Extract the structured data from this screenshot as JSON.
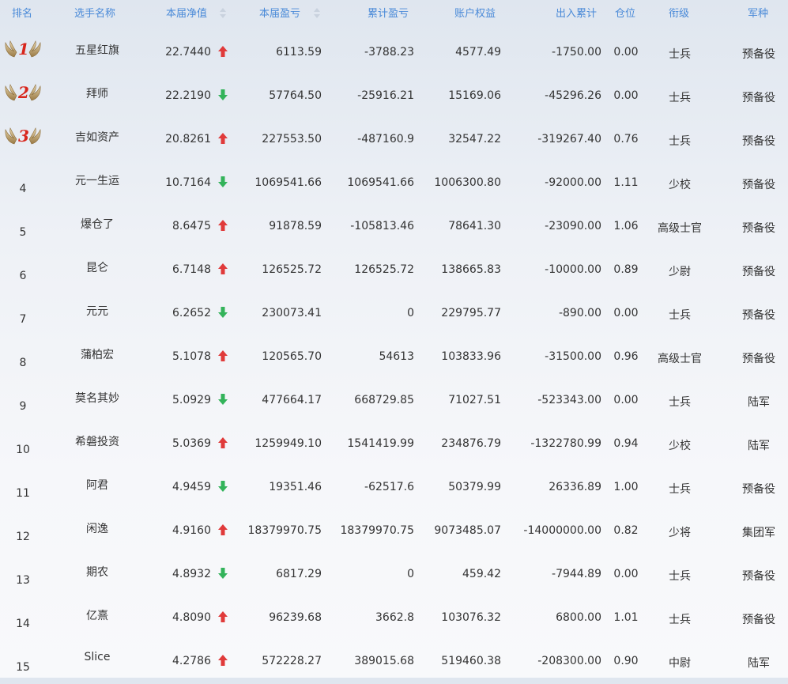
{
  "header": {
    "rank": "排名",
    "name": "选手名称",
    "net_value": "本届净值",
    "pnl": "本届盈亏",
    "cum_pnl": "累计盈亏",
    "equity": "账户权益",
    "io": "出入累计",
    "position": "仓位",
    "title": "衔级",
    "branch": "军种"
  },
  "colors": {
    "up": "#e03a3a",
    "down": "#33b35a",
    "header": "#4a8ad8"
  },
  "rows": [
    {
      "rank": "1",
      "name": "五星红旗",
      "net_value": "22.7440",
      "trend": "up",
      "pnl": "6113.59",
      "cum_pnl": "-3788.23",
      "equity": "4577.49",
      "io": "-1750.00",
      "position": "0.00",
      "title": "士兵",
      "branch": "预备役"
    },
    {
      "rank": "2",
      "name": "拜师",
      "net_value": "22.2190",
      "trend": "down",
      "pnl": "57764.50",
      "cum_pnl": "-25916.21",
      "equity": "15169.06",
      "io": "-45296.26",
      "position": "0.00",
      "title": "士兵",
      "branch": "预备役"
    },
    {
      "rank": "3",
      "name": "吉如资产",
      "net_value": "20.8261",
      "trend": "up",
      "pnl": "227553.50",
      "cum_pnl": "-487160.9",
      "equity": "32547.22",
      "io": "-319267.40",
      "position": "0.76",
      "title": "士兵",
      "branch": "预备役"
    },
    {
      "rank": "4",
      "name": "元一生运",
      "net_value": "10.7164",
      "trend": "down",
      "pnl": "1069541.66",
      "cum_pnl": "1069541.66",
      "equity": "1006300.80",
      "io": "-92000.00",
      "position": "1.11",
      "title": "少校",
      "branch": "预备役"
    },
    {
      "rank": "5",
      "name": "爆仓了",
      "net_value": "8.6475",
      "trend": "up",
      "pnl": "91878.59",
      "cum_pnl": "-105813.46",
      "equity": "78641.30",
      "io": "-23090.00",
      "position": "1.06",
      "title": "高级士官",
      "branch": "预备役"
    },
    {
      "rank": "6",
      "name": "昆仑",
      "net_value": "6.7148",
      "trend": "up",
      "pnl": "126525.72",
      "cum_pnl": "126525.72",
      "equity": "138665.83",
      "io": "-10000.00",
      "position": "0.89",
      "title": "少尉",
      "branch": "预备役"
    },
    {
      "rank": "7",
      "name": "元元",
      "net_value": "6.2652",
      "trend": "down",
      "pnl": "230073.41",
      "cum_pnl": "0",
      "equity": "229795.77",
      "io": "-890.00",
      "position": "0.00",
      "title": "士兵",
      "branch": "预备役"
    },
    {
      "rank": "8",
      "name": "蒲柏宏",
      "net_value": "5.1078",
      "trend": "up",
      "pnl": "120565.70",
      "cum_pnl": "54613",
      "equity": "103833.96",
      "io": "-31500.00",
      "position": "0.96",
      "title": "高级士官",
      "branch": "预备役"
    },
    {
      "rank": "9",
      "name": "莫名其妙",
      "net_value": "5.0929",
      "trend": "down",
      "pnl": "477664.17",
      "cum_pnl": "668729.85",
      "equity": "71027.51",
      "io": "-523343.00",
      "position": "0.00",
      "title": "士兵",
      "branch": "陆军"
    },
    {
      "rank": "10",
      "name": "希磐投资",
      "net_value": "5.0369",
      "trend": "up",
      "pnl": "1259949.10",
      "cum_pnl": "1541419.99",
      "equity": "234876.79",
      "io": "-1322780.99",
      "position": "0.94",
      "title": "少校",
      "branch": "陆军"
    },
    {
      "rank": "11",
      "name": "阿君",
      "net_value": "4.9459",
      "trend": "down",
      "pnl": "19351.46",
      "cum_pnl": "-62517.6",
      "equity": "50379.99",
      "io": "26336.89",
      "position": "1.00",
      "title": "士兵",
      "branch": "预备役"
    },
    {
      "rank": "12",
      "name": "闲逸",
      "net_value": "4.9160",
      "trend": "up",
      "pnl": "18379970.75",
      "cum_pnl": "18379970.75",
      "equity": "9073485.07",
      "io": "-14000000.00",
      "position": "0.82",
      "title": "少将",
      "branch": "集团军"
    },
    {
      "rank": "13",
      "name": "期农",
      "net_value": "4.8932",
      "trend": "down",
      "pnl": "6817.29",
      "cum_pnl": "0",
      "equity": "459.42",
      "io": "-7944.89",
      "position": "0.00",
      "title": "士兵",
      "branch": "预备役"
    },
    {
      "rank": "14",
      "name": "亿熹",
      "net_value": "4.8090",
      "trend": "up",
      "pnl": "96239.68",
      "cum_pnl": "3662.8",
      "equity": "103076.32",
      "io": "6800.00",
      "position": "1.01",
      "title": "士兵",
      "branch": "预备役"
    },
    {
      "rank": "15",
      "name": "Slice",
      "net_value": "4.2786",
      "trend": "up",
      "pnl": "572228.27",
      "cum_pnl": "389015.68",
      "equity": "519460.38",
      "io": "-208300.00",
      "position": "0.90",
      "title": "中尉",
      "branch": "陆军"
    }
  ]
}
